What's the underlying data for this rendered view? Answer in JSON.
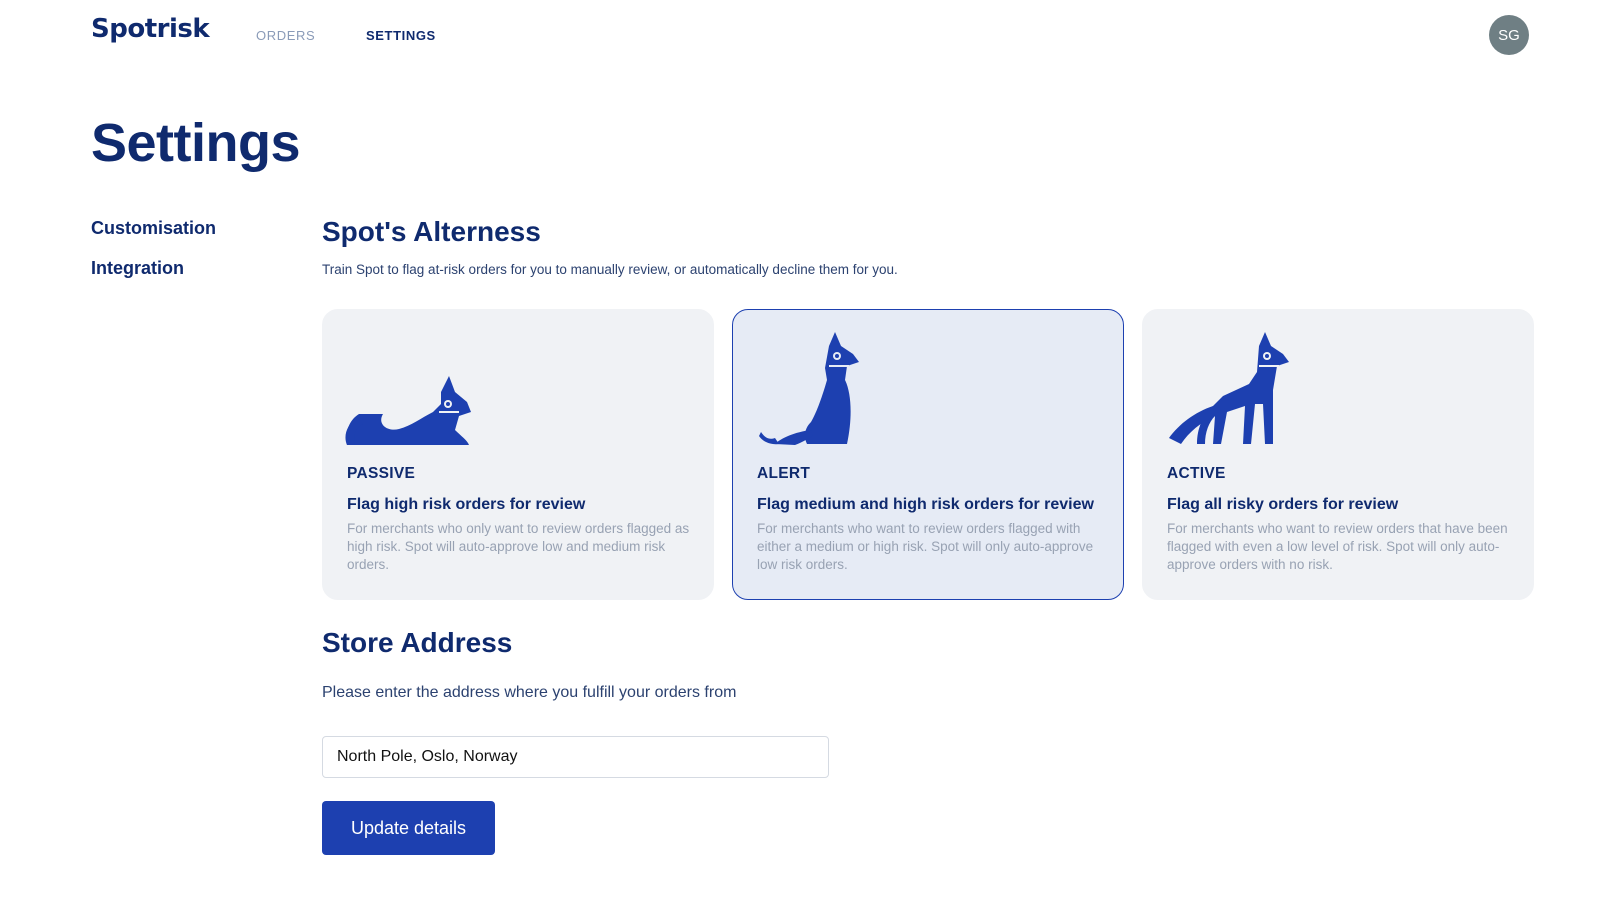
{
  "brand": {
    "logo": "Spotrisk",
    "accent": "#1d40b0",
    "text_dark": "#0f2a6e"
  },
  "nav": {
    "orders": "ORDERS",
    "settings": "SETTINGS",
    "active": "SETTINGS"
  },
  "user": {
    "initials": "SG"
  },
  "page": {
    "title": "Settings"
  },
  "sidebar": {
    "items": [
      {
        "label": "Customisation"
      },
      {
        "label": "Integration"
      }
    ]
  },
  "alertness": {
    "title": "Spot's Alterness",
    "description": "Train Spot to flag at-risk orders for you to manually review, or automatically decline them for you.",
    "selected": "ALERT",
    "options": [
      {
        "level": "PASSIVE",
        "heading": "Flag high risk orders for review",
        "body": "For merchants who only want to review orders flagged as high risk. Spot will auto-approve low and medium risk orders.",
        "icon": "lying-fox-icon"
      },
      {
        "level": "ALERT",
        "heading": "Flag medium and high risk orders for review",
        "body": "For merchants who want to review orders flagged with either a medium or high risk. Spot will only auto-approve low risk orders.",
        "icon": "sitting-fox-icon"
      },
      {
        "level": "ACTIVE",
        "heading": "Flag all risky orders for review",
        "body": "For merchants who want to review orders that have been flagged with even a low level of risk. Spot will only auto-approve orders with no risk.",
        "icon": "standing-fox-icon"
      }
    ]
  },
  "store": {
    "title": "Store Address",
    "description": "Please enter the address where you fulfill your orders from",
    "address_value": "North Pole, Oslo, Norway",
    "button_label": "Update details"
  }
}
